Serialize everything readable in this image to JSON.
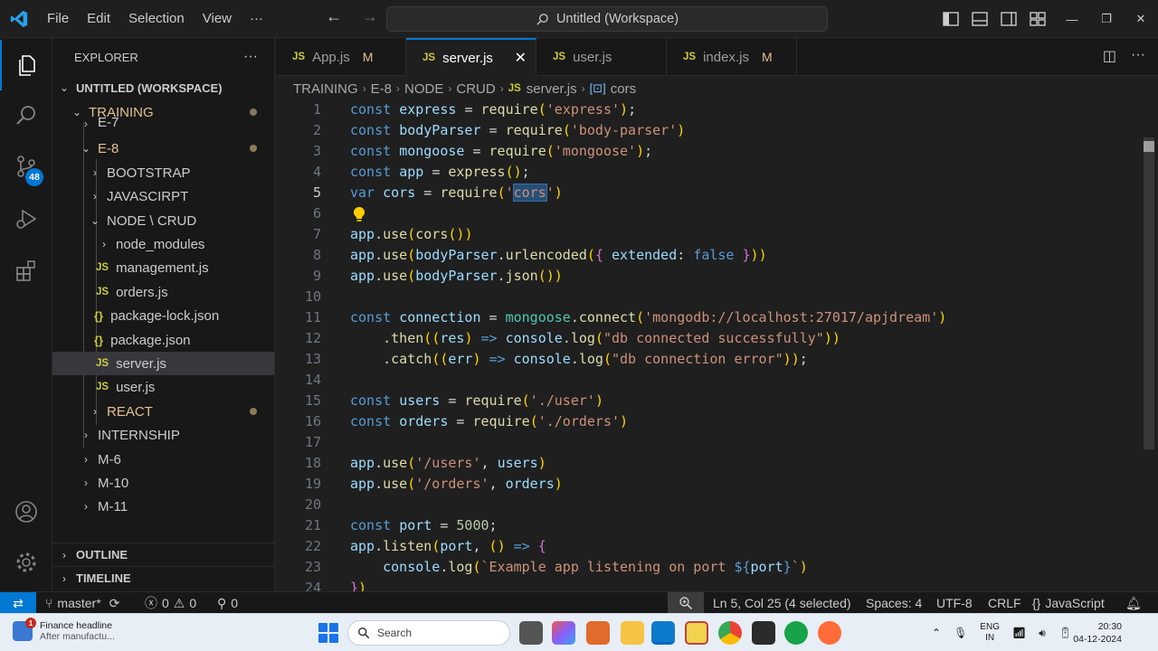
{
  "titlebar": {
    "menu": [
      "File",
      "Edit",
      "Selection",
      "View",
      "···"
    ],
    "command_center": "Untitled (Workspace)",
    "window_controls": [
      "minimize-icon",
      "restore-icon",
      "close-icon"
    ]
  },
  "activity_bar": {
    "items": [
      "explorer-icon",
      "search-icon",
      "source-control-icon",
      "run-debug-icon",
      "extensions-icon",
      "accounts-icon",
      "manage-gear-icon"
    ],
    "source_control_badge": "48",
    "accent": "#0078d4"
  },
  "sidebar": {
    "header": "EXPLORER",
    "more": "···",
    "workspace": "UNTITLED (WORKSPACE)",
    "tree": [
      {
        "label": "TRAINING",
        "indent": 1,
        "chevron": "down",
        "modified": true
      },
      {
        "label": "E-7",
        "indent": 2,
        "chevron": "right",
        "modified": false
      },
      {
        "label": "E-8",
        "indent": 2,
        "chevron": "down",
        "modified": true
      },
      {
        "label": "BOOTSTRAP",
        "indent": 3,
        "chevron": "right",
        "modified": false
      },
      {
        "label": "JAVASCIRPT",
        "indent": 3,
        "chevron": "right",
        "modified": false
      },
      {
        "label": "NODE \\ CRUD",
        "indent": 3,
        "chevron": "down",
        "modified": false
      },
      {
        "label": "node_modules",
        "indent": 4,
        "chevron": "right",
        "modified": false
      },
      {
        "label": "management.js",
        "indent": 4,
        "type": "js"
      },
      {
        "label": "orders.js",
        "indent": 4,
        "type": "js"
      },
      {
        "label": "package-lock.json",
        "indent": 4,
        "type": "json"
      },
      {
        "label": "package.json",
        "indent": 4,
        "type": "json"
      },
      {
        "label": "server.js",
        "indent": 4,
        "type": "js",
        "selected": true
      },
      {
        "label": "user.js",
        "indent": 4,
        "type": "js"
      },
      {
        "label": "REACT",
        "indent": 3,
        "chevron": "right",
        "modified": true
      },
      {
        "label": "INTERNSHIP",
        "indent": 2,
        "chevron": "right"
      },
      {
        "label": "M-6",
        "indent": 2,
        "chevron": "right"
      },
      {
        "label": "M-10",
        "indent": 2,
        "chevron": "right"
      },
      {
        "label": "M-11",
        "indent": 2,
        "chevron": "right"
      }
    ],
    "outline": "OUTLINE",
    "timeline": "TIMELINE"
  },
  "tabs": [
    {
      "label": "App.js",
      "badge": "M",
      "active": false
    },
    {
      "label": "server.js",
      "badge": "",
      "active": true
    },
    {
      "label": "user.js",
      "badge": "",
      "active": false
    },
    {
      "label": "index.js",
      "badge": "M",
      "active": false
    }
  ],
  "breadcrumb": {
    "parts": [
      "TRAINING",
      "E-8",
      "NODE",
      "CRUD",
      "server.js"
    ],
    "symbol": "cors"
  },
  "editor": {
    "cursor_line": 5,
    "lines": [
      "const express = require('express');",
      "const bodyParser = require('body-parser')",
      "const mongoose = require('mongoose');",
      "const app = express();",
      "var cors = require('cors')",
      "",
      "app.use(cors())",
      "app.use(bodyParser.urlencoded({ extended: false }))",
      "app.use(bodyParser.json())",
      "",
      "const connection = mongoose.connect('mongodb://localhost:27017/apjdream')",
      "    .then((res) => console.log(\"db connected successfully\"))",
      "    .catch((err) => console.log(\"db connection error\"));",
      "",
      "const users = require('./user')",
      "const orders = require('./orders')",
      "",
      "app.use('/users', users)",
      "app.use('/orders', orders)",
      "",
      "const port = 5000;",
      "app.listen(port, () => {",
      "    console.log(`Example app listening on port ${port}`)",
      "})"
    ]
  },
  "statusbar": {
    "branch": "master*",
    "errors": "0",
    "warnings": "0",
    "ports": "0",
    "position": "Ln 5, Col 25 (4 selected)",
    "spaces": "Spaces: 4",
    "encoding": "UTF-8",
    "eol": "CRLF",
    "language": "JavaScript"
  },
  "taskbar": {
    "news_title": "Finance headline",
    "news_sub": "After manufactu...",
    "news_badge": "1",
    "search_placeholder": "Search",
    "lang_top": "ENG",
    "lang_bottom": "IN",
    "time": "20:30",
    "date": "04-12-2024"
  }
}
